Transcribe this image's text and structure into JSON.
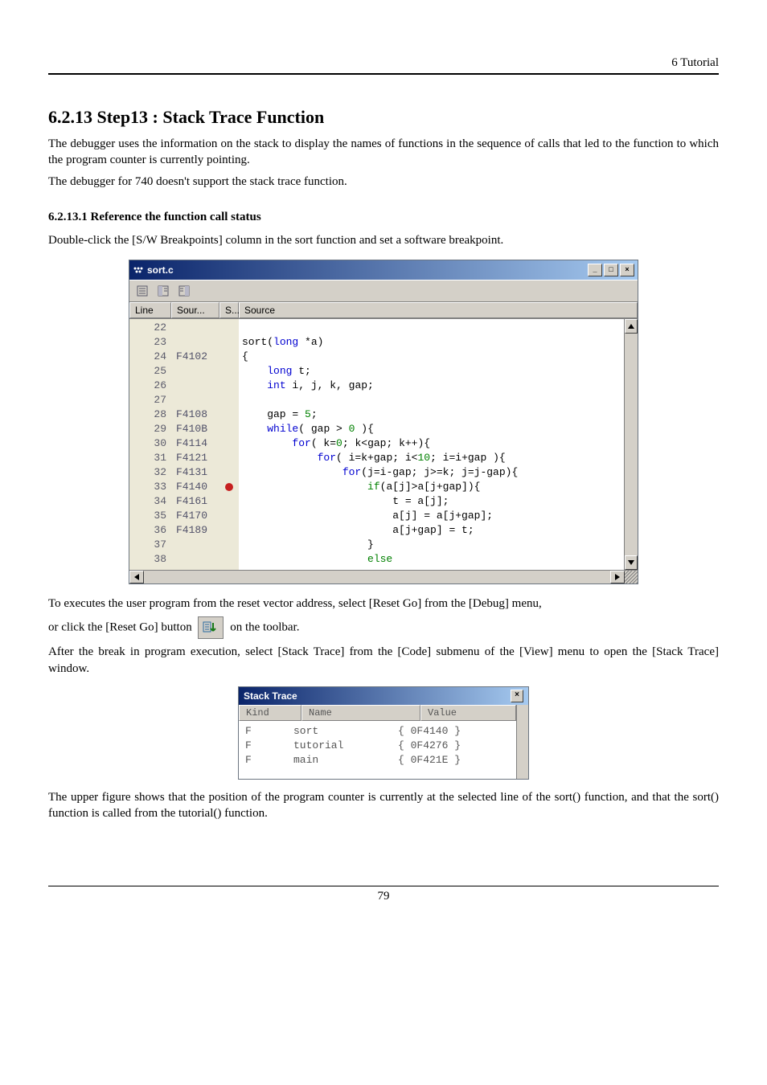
{
  "header": {
    "right": "6 Tutorial"
  },
  "section": {
    "title": "6.2.13 Step13 : Stack Trace Function",
    "para1": "The debugger uses the information on the stack to display the names of functions in the sequence of calls that led to the function to which the program counter is currently pointing.",
    "para2": "The debugger for 740 doesn't support the stack trace function."
  },
  "subsection": {
    "title": "6.2.13.1 Reference the function call status",
    "para": "Double-click the [S/W Breakpoints] column in the sort function and set a software breakpoint."
  },
  "code_window": {
    "filename": "sort.c",
    "win_buttons": {
      "min": "_",
      "max": "□",
      "close": "×"
    },
    "columns": {
      "line": "Line",
      "source_addr": "Sour...",
      "breakpoint": "S...",
      "source": "Source"
    },
    "rows": [
      {
        "line": "22",
        "addr": "",
        "bp": "",
        "html": ""
      },
      {
        "line": "23",
        "addr": "",
        "bp": "",
        "html": "sort(<span class='kw'>long</span> *a)"
      },
      {
        "line": "24",
        "addr": "F4102",
        "bp": "",
        "html": "{"
      },
      {
        "line": "25",
        "addr": "",
        "bp": "",
        "html": "    <span class='kw'>long</span> t;"
      },
      {
        "line": "26",
        "addr": "",
        "bp": "",
        "html": "    <span class='kw'>int</span> i, j, k, gap;"
      },
      {
        "line": "27",
        "addr": "",
        "bp": "",
        "html": ""
      },
      {
        "line": "28",
        "addr": "F4108",
        "bp": "",
        "html": "    gap = <span class='num'>5</span>;"
      },
      {
        "line": "29",
        "addr": "F410B",
        "bp": "",
        "html": "    <span class='kw'>while</span>( gap &gt; <span class='num'>0</span> ){"
      },
      {
        "line": "30",
        "addr": "F4114",
        "bp": "",
        "html": "        <span class='kw'>for</span>( k=<span class='num'>0</span>; k&lt;gap; k++){"
      },
      {
        "line": "31",
        "addr": "F4121",
        "bp": "",
        "html": "            <span class='kw'>for</span>( i=k+gap; i&lt;<span class='num'>10</span>; i=i+gap ){"
      },
      {
        "line": "32",
        "addr": "F4131",
        "bp": "",
        "html": "                <span class='kw'>for</span>(j=i-gap; j&gt;=k; j=j-gap){"
      },
      {
        "line": "33",
        "addr": "F4140",
        "bp": "●",
        "html": "                    <span class='alt'>if</span>(a[j]&gt;a[j+gap]){"
      },
      {
        "line": "34",
        "addr": "F4161",
        "bp": "",
        "html": "                        t = a[j];"
      },
      {
        "line": "35",
        "addr": "F4170",
        "bp": "",
        "html": "                        a[j] = a[j+gap];"
      },
      {
        "line": "36",
        "addr": "F4189",
        "bp": "",
        "html": "                        a[j+gap] = t;"
      },
      {
        "line": "37",
        "addr": "",
        "bp": "",
        "html": "                    }"
      },
      {
        "line": "38",
        "addr": "",
        "bp": "",
        "html": "                    <span class='alt'>else</span>"
      }
    ]
  },
  "para_after_code1": "To executes the user program from the reset vector address, select [Reset Go] from the [Debug] menu,",
  "para_after_code2_a": "or click the [Reset Go] button ",
  "para_after_code2_b": " on the toolbar.",
  "para_after_code3": "After the break in program execution, select [Stack Trace] from the [Code] submenu of the [View] menu to open the [Stack Trace] window.",
  "stack_window": {
    "title": "StackTrace",
    "title_display": "Stack Trace",
    "columns": {
      "kind": "Kind",
      "name": "Name",
      "value": "Value"
    },
    "rows": [
      {
        "kind": "F",
        "name": "sort",
        "value": "{ 0F4140 }"
      },
      {
        "kind": "F",
        "name": "tutorial",
        "value": "{ 0F4276 }"
      },
      {
        "kind": "F",
        "name": "main",
        "value": "{ 0F421E }"
      }
    ]
  },
  "para_bottom": "The upper figure shows that the position of the program counter is currently at the selected line of the sort() function, and that the sort() function is called from the tutorial() function.",
  "page_number": "79"
}
